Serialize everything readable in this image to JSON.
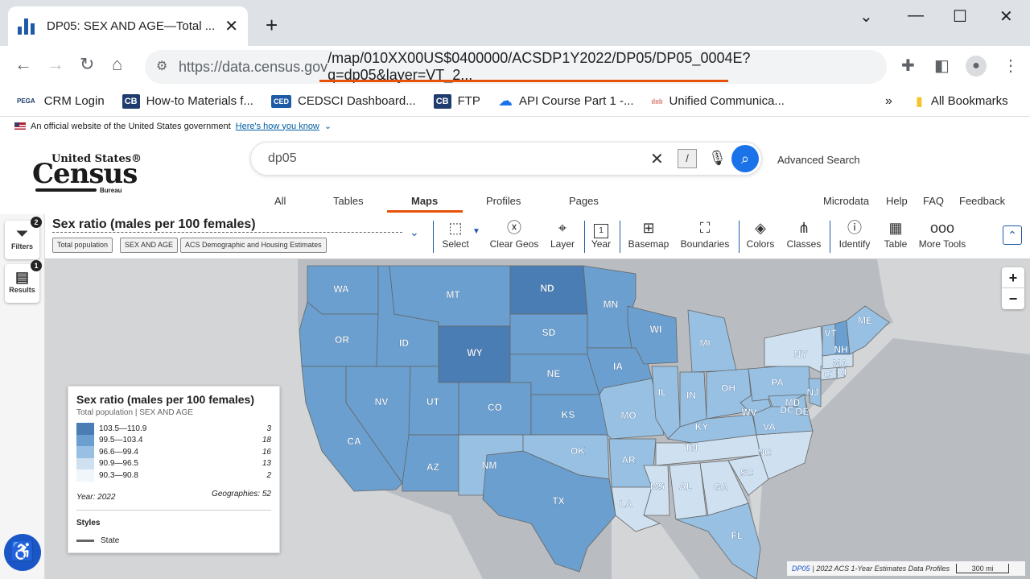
{
  "browser": {
    "tab_title": "DP05: SEX AND AGE—Total ... in",
    "url_host": "https://data.census.gov",
    "url_path": "/map/010XX00US$0400000/ACSDP1Y2022/DP05/DP05_0004E?q=dp05&layer=VT_2...",
    "bookmarks": [
      {
        "icon": "PEGA",
        "label": "CRM Login"
      },
      {
        "icon": "CB",
        "label": "How-to Materials f..."
      },
      {
        "icon": "CED",
        "label": "CEDSCI Dashboard..."
      },
      {
        "icon": "CB",
        "label": "FTP"
      },
      {
        "icon": "cloud",
        "label": "API Course Part 1 -..."
      },
      {
        "icon": "cisco",
        "label": "Unified Communica..."
      }
    ],
    "bookmarks_overflow": "»",
    "all_bookmarks": "All Bookmarks"
  },
  "gov_banner": {
    "text": "An official website of the United States government",
    "link": "Here's how you know"
  },
  "logo": {
    "line1": "United States®",
    "line2": "Census",
    "line3": "Bureau"
  },
  "search": {
    "value": "dp05",
    "slash": "/",
    "advanced": "Advanced Search"
  },
  "nav": {
    "tabs": [
      "All",
      "Tables",
      "Maps",
      "Profiles",
      "Pages"
    ],
    "right": [
      "Microdata",
      "Help",
      "FAQ",
      "Feedback"
    ]
  },
  "rail": {
    "filters_label": "Filters",
    "filters_count": "2",
    "results_label": "Results",
    "results_count": "1"
  },
  "map_toolbar": {
    "title": "Sex ratio (males per 100 females)",
    "chips": [
      "Total population",
      "SEX AND AGE",
      "ACS Demographic and Housing Estimates"
    ],
    "tools": [
      "Select",
      "Clear Geos",
      "Layer",
      "Year",
      "Basemap",
      "Boundaries",
      "Colors",
      "Classes",
      "Identify",
      "Table",
      "More Tools"
    ],
    "year_icon": "1"
  },
  "legend": {
    "title": "Sex ratio (males per 100 females)",
    "subtitle": "Total population | SEX AND AGE",
    "classes": [
      {
        "range": "103.5—110.9",
        "count": "3",
        "color": "#4a7db3"
      },
      {
        "range": "99.5—103.4",
        "count": "18",
        "color": "#6a9fcf"
      },
      {
        "range": "96.6—99.4",
        "count": "16",
        "color": "#98c0e2"
      },
      {
        "range": "90.9—96.5",
        "count": "13",
        "color": "#cfe1f1"
      },
      {
        "range": "90.3—90.8",
        "count": "2",
        "color": "#f1f6fb"
      }
    ],
    "year": "Year: 2022",
    "geographies": "Geographies: 52",
    "styles_label": "Styles",
    "state_label": "State"
  },
  "states": [
    "WA",
    "MT",
    "ND",
    "MN",
    "OR",
    "ID",
    "WY",
    "SD",
    "WI",
    "MI",
    "ME",
    "VT",
    "NH",
    "NY",
    "MA",
    "CT",
    "RI",
    "IA",
    "NE",
    "NV",
    "UT",
    "CO",
    "KS",
    "MO",
    "IL",
    "IN",
    "OH",
    "PA",
    "NJ",
    "MD",
    "DC",
    "DE",
    "WV",
    "VA",
    "KY",
    "CA",
    "OK",
    "AR",
    "TN",
    "NC",
    "SC",
    "AZ",
    "NM",
    "TX",
    "MS",
    "AL",
    "GA",
    "LA",
    "FL"
  ],
  "attribution": {
    "link": "DP05",
    "text": "| 2022 ACS 1-Year Estimates Data Profiles",
    "scale": "300 mi"
  },
  "zoom": {
    "in": "+",
    "out": "−"
  }
}
